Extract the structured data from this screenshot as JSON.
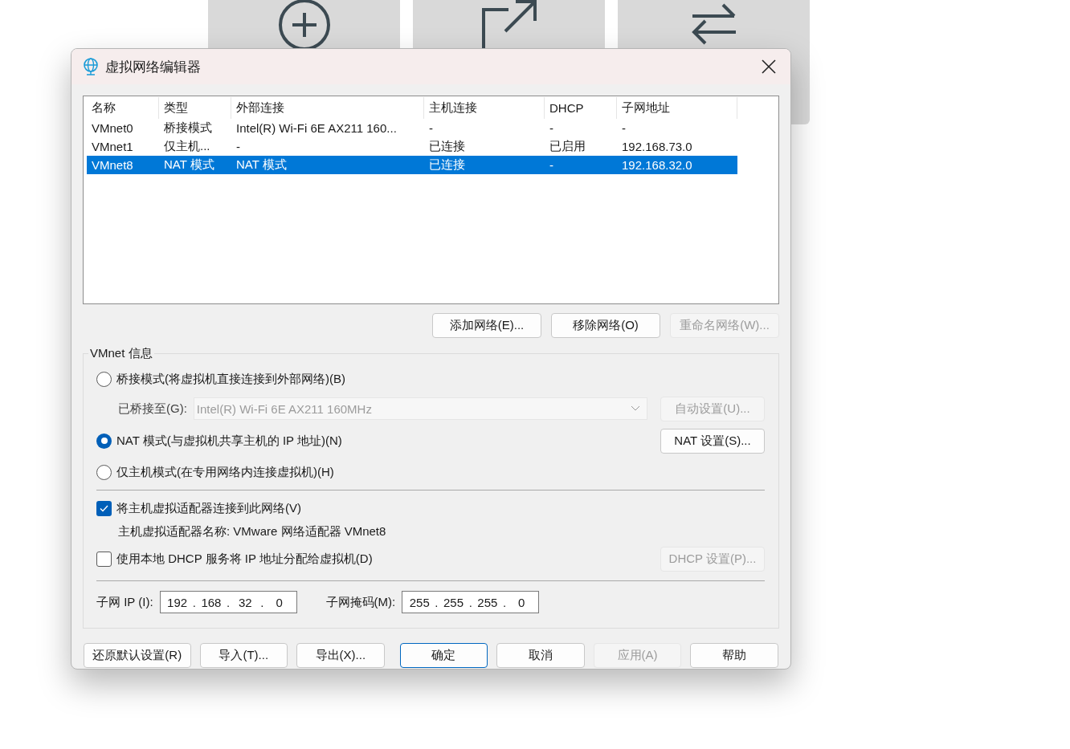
{
  "window": {
    "title": "虚拟网络编辑器"
  },
  "table": {
    "columns": [
      "名称",
      "类型",
      "外部连接",
      "主机连接",
      "DHCP",
      "子网地址"
    ],
    "rows": [
      {
        "cells": [
          "VMnet0",
          "桥接模式",
          "Intel(R) Wi-Fi 6E AX211 160...",
          "-",
          "-",
          "-"
        ],
        "selected": false
      },
      {
        "cells": [
          "VMnet1",
          "仅主机...",
          "-",
          "已连接",
          "已启用",
          "192.168.73.0"
        ],
        "selected": false
      },
      {
        "cells": [
          "VMnet8",
          "NAT 模式",
          "NAT 模式",
          "已连接",
          "-",
          "192.168.32.0"
        ],
        "selected": true
      }
    ]
  },
  "table_buttons": [
    {
      "label": "添加网络(E)...",
      "disabled": false
    },
    {
      "label": "移除网络(O)",
      "disabled": false
    },
    {
      "label": "重命名网络(W)...",
      "disabled": true
    }
  ],
  "vmnet_info": {
    "title": "VMnet 信息",
    "modes": [
      {
        "label": "桥接模式(将虚拟机直接连接到外部网络)(B)",
        "selected": false
      },
      {
        "label": "NAT 模式(与虚拟机共享主机的 IP 地址)(N)",
        "selected": true
      },
      {
        "label": "仅主机模式(在专用网络内连接虚拟机)(H)",
        "selected": false
      }
    ],
    "bridged_to": {
      "label": "已桥接至(G):",
      "value": "Intel(R) Wi-Fi 6E AX211 160MHz",
      "disabled": true
    },
    "auto_button": {
      "label": "自动设置(U)...",
      "disabled": true
    },
    "nat_button": {
      "label": "NAT 设置(S)...",
      "disabled": false
    },
    "connect_adapter": {
      "label": "将主机虚拟适配器连接到此网络(V)",
      "checked": true
    },
    "adapter_name": "主机虚拟适配器名称: VMware 网络适配器 VMnet8",
    "dhcp": {
      "label": "使用本地 DHCP 服务将 IP 地址分配给虚拟机(D)",
      "checked": false
    },
    "dhcp_button": {
      "label": "DHCP 设置(P)...",
      "disabled": true
    },
    "subnet_ip": {
      "label": "子网 IP (I):",
      "octets": [
        "192",
        "168",
        "32",
        "0"
      ],
      "separator": "."
    },
    "subnet_mask": {
      "label": "子网掩码(M):",
      "octets": [
        "255",
        "255",
        "255",
        "0"
      ],
      "separator": "."
    }
  },
  "footer_buttons": [
    {
      "label": "还原默认设置(R)",
      "disabled": false,
      "default": false
    },
    {
      "label": "导入(T)...",
      "disabled": false,
      "default": false
    },
    {
      "label": "导出(X)...",
      "disabled": false,
      "default": false
    },
    {
      "label": "确定",
      "disabled": false,
      "default": true
    },
    {
      "label": "取消",
      "disabled": false,
      "default": false
    },
    {
      "label": "应用(A)",
      "disabled": true,
      "default": false
    },
    {
      "label": "帮助",
      "disabled": false,
      "default": false
    }
  ]
}
